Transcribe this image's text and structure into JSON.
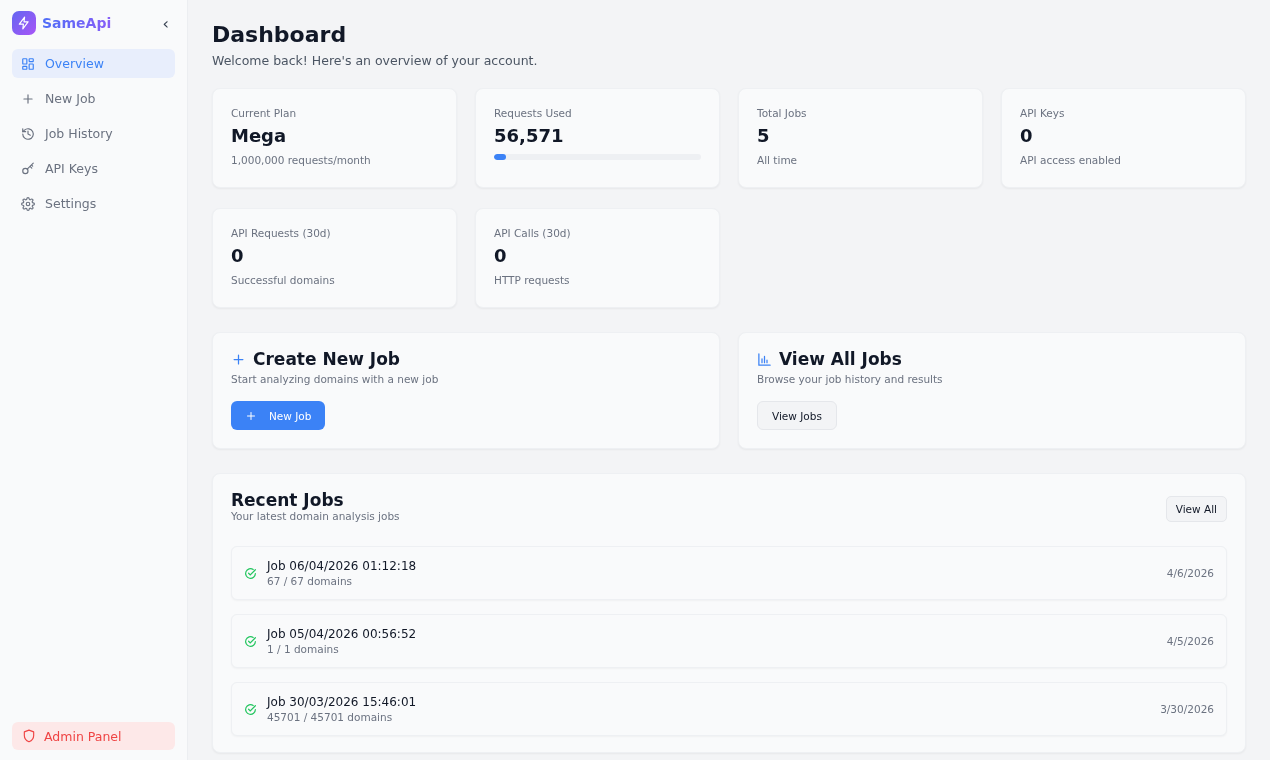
{
  "sidebar": {
    "brand": "SameApi",
    "collapse": "‹",
    "items": [
      {
        "label": "Overview",
        "kind": "grid",
        "selected": true
      },
      {
        "label": "New Job",
        "kind": "plus",
        "selected": false
      },
      {
        "label": "Job History",
        "kind": "history",
        "selected": false
      },
      {
        "label": "API Keys",
        "kind": "key",
        "selected": false
      },
      {
        "label": "Settings",
        "kind": "gear",
        "selected": false
      }
    ],
    "admin_button": "Admin Panel"
  },
  "header": {
    "title": "Dashboard",
    "subtitle": "Welcome back! Here's an overview of your account."
  },
  "stats": [
    {
      "label": "Current Plan",
      "value": "Mega",
      "note": "1,000,000 requests/month"
    },
    {
      "label": "Requests Used",
      "value": "56,571",
      "level": 0.06
    },
    {
      "label": "Total Jobs",
      "value": "5",
      "note": "All time"
    },
    {
      "label": "API Keys",
      "value": "0",
      "note": "API access enabled"
    },
    {
      "label": "API Requests (30d)",
      "value": "0",
      "note": "Successful domains"
    },
    {
      "label": "API Calls (30d)",
      "value": "0",
      "note": "HTTP requests"
    }
  ],
  "actions": [
    {
      "title": "Create New Job",
      "text": "Start analyzing domains with a new job",
      "button": "New Job",
      "kind": "primary"
    },
    {
      "title": "View All Jobs",
      "text": "Browse your job history and results",
      "button": "View Jobs",
      "kind": "secondary"
    }
  ],
  "recent_jobs": {
    "title": "Recent Jobs",
    "subtitle": "Your latest domain analysis jobs",
    "button": "View All",
    "rows": [
      {
        "name": "Job 06/04/2026 01:12:18",
        "domains": "67 / 67 domains",
        "date": "4/6/2026",
        "done": true
      },
      {
        "name": "Job 05/04/2026 00:56:52",
        "domains": "1 / 1 domains",
        "date": "4/5/2026",
        "done": true
      },
      {
        "name": "Job 30/03/2026 15:46:01",
        "domains": "45701 / 45701 domains",
        "date": "3/30/2026",
        "done": true
      }
    ]
  }
}
